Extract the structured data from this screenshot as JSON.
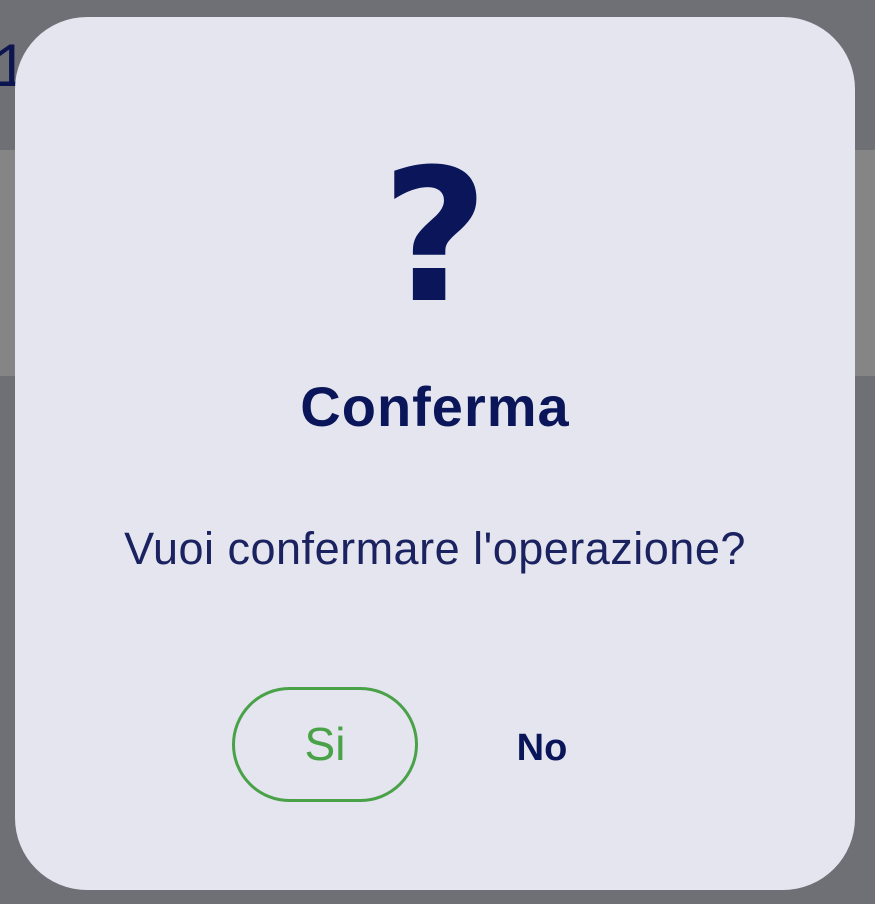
{
  "background": {
    "partial_text": "1"
  },
  "dialog": {
    "icon": "question-mark-icon",
    "icon_glyph": "?",
    "title": "Conferma",
    "message": "Vuoi confermare l'operazione?",
    "yes_label": "Si",
    "no_label": "No",
    "colors": {
      "primary": "#0a1659",
      "confirm": "#4aa248",
      "surface": "#e4e5ee",
      "overlay": "#6f7075"
    }
  }
}
